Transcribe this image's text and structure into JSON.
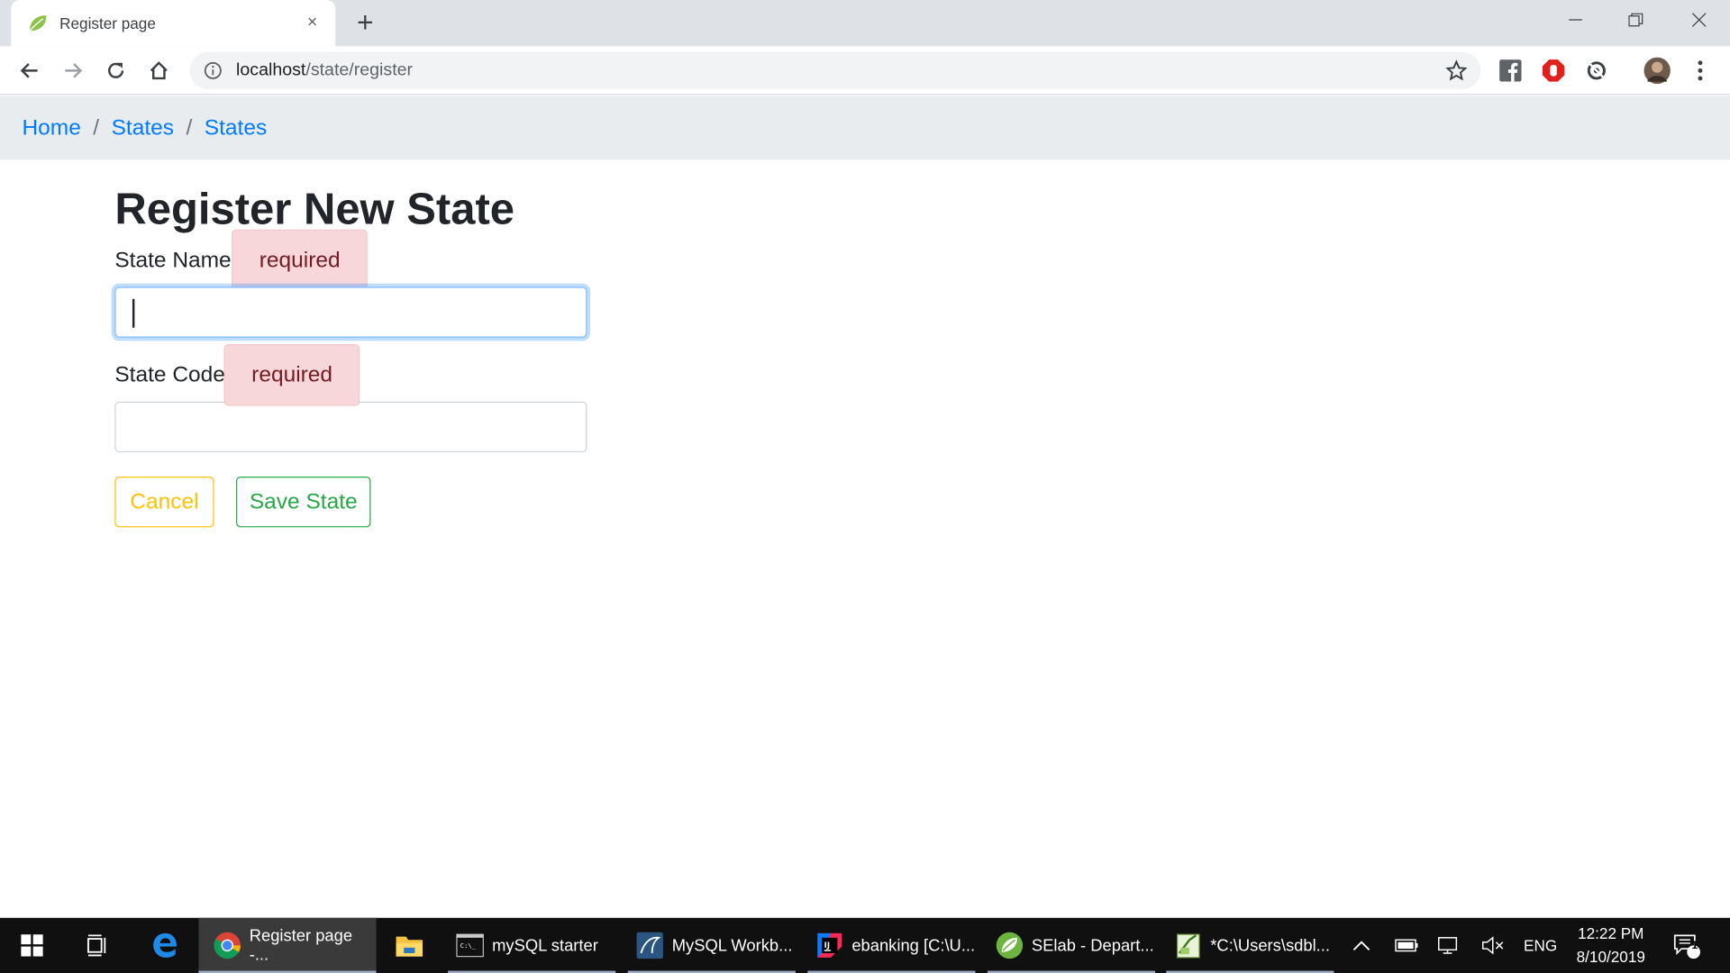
{
  "browser": {
    "tab_title": "Register page",
    "tab_close": "×",
    "new_tab": "+",
    "url_host": "localhost",
    "url_path": "/state/register"
  },
  "breadcrumb": {
    "items": [
      "Home",
      "States",
      "States"
    ],
    "separator": "/"
  },
  "form": {
    "title": "Register New State",
    "state_name_label": "State Name",
    "state_name_badge": "required",
    "state_name_value": "",
    "state_code_label": "State Code",
    "state_code_badge": "required",
    "state_code_value": "",
    "cancel_label": "Cancel",
    "save_label": "Save State"
  },
  "colors": {
    "link": "#007bff",
    "badge_bg": "#f8d7da",
    "cancel": "#ffc107",
    "save": "#28a745"
  },
  "taskbar": {
    "items": [
      {
        "label": "Register page -...",
        "icon": "chrome-icon"
      },
      {
        "label": "",
        "icon": "file-explorer-icon"
      },
      {
        "label": "mySQL starter",
        "icon": "terminal-icon"
      },
      {
        "label": "MySQL Workb...",
        "icon": "mysql-workbench-icon"
      },
      {
        "label": "ebanking [C:\\U...",
        "icon": "intellij-icon"
      },
      {
        "label": "SElab - Depart...",
        "icon": "spring-icon"
      },
      {
        "label": "*C:\\Users\\sdbl...",
        "icon": "notepad-icon"
      }
    ],
    "language": "ENG",
    "time": "12:22 PM",
    "date": "8/10/2019",
    "notification_count": "1"
  }
}
